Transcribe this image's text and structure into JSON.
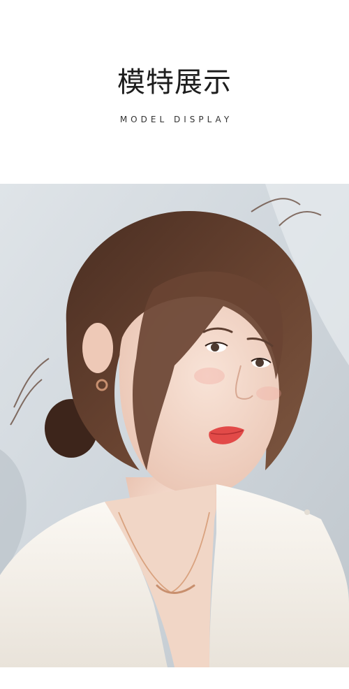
{
  "header": {
    "title": "模特展示",
    "subtitle": "MODEL DISPLAY"
  },
  "colors": {
    "background": "#ffffff",
    "title": "#1d1d1d",
    "photo_backdrop": "#d6dde2",
    "hair": "#5b3a2a",
    "skin": "#f3d6c8",
    "lips": "#e24a48",
    "blouse": "#f6f2ec",
    "necklace": "#d9a27f"
  }
}
